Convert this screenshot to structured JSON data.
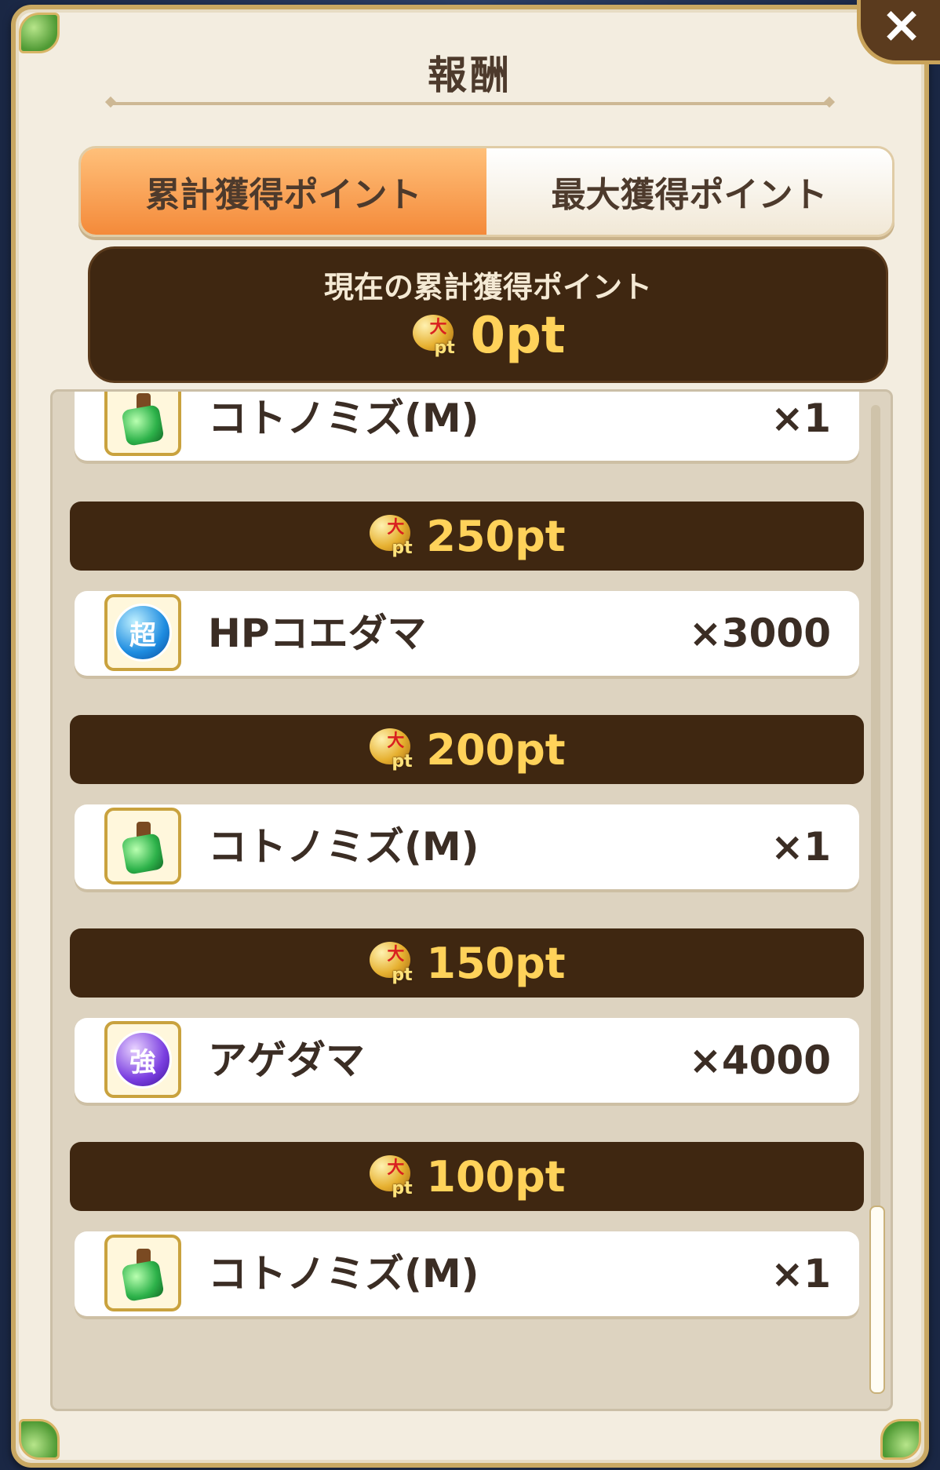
{
  "dialog": {
    "title": "報酬",
    "close_label": "×"
  },
  "tabs": [
    {
      "label": "累計獲得ポイント",
      "active": true
    },
    {
      "label": "最大獲得ポイント",
      "active": false
    }
  ],
  "current_points": {
    "label": "現在の累計獲得ポイント",
    "value": "0pt"
  },
  "icons": {
    "points": "pt-coin-icon",
    "potion": "kotonomizu-potion-icon",
    "orb_blue": "chou-orb-icon",
    "orb_purple": "kyou-orb-icon"
  },
  "rewards": {
    "top_partial": {
      "name": "コトノミズ(M)",
      "qty": "×1"
    },
    "tiers": [
      {
        "points": "250pt",
        "item": {
          "name": "HPコエダマ",
          "qty": "×3000",
          "icon_char": "超"
        }
      },
      {
        "points": "200pt",
        "item": {
          "name": "コトノミズ(M)",
          "qty": "×1"
        }
      },
      {
        "points": "150pt",
        "item": {
          "name": "アゲダマ",
          "qty": "×4000",
          "icon_char": "強"
        }
      },
      {
        "points": "100pt",
        "item": {
          "name": "コトノミズ(M)",
          "qty": "×1"
        }
      }
    ]
  },
  "colors": {
    "frame": "#c9a862",
    "panel": "#f3ede0",
    "dark_brown": "#3f2711",
    "gold_text": "#ffd25a",
    "active_tab": "#f48a3a"
  }
}
